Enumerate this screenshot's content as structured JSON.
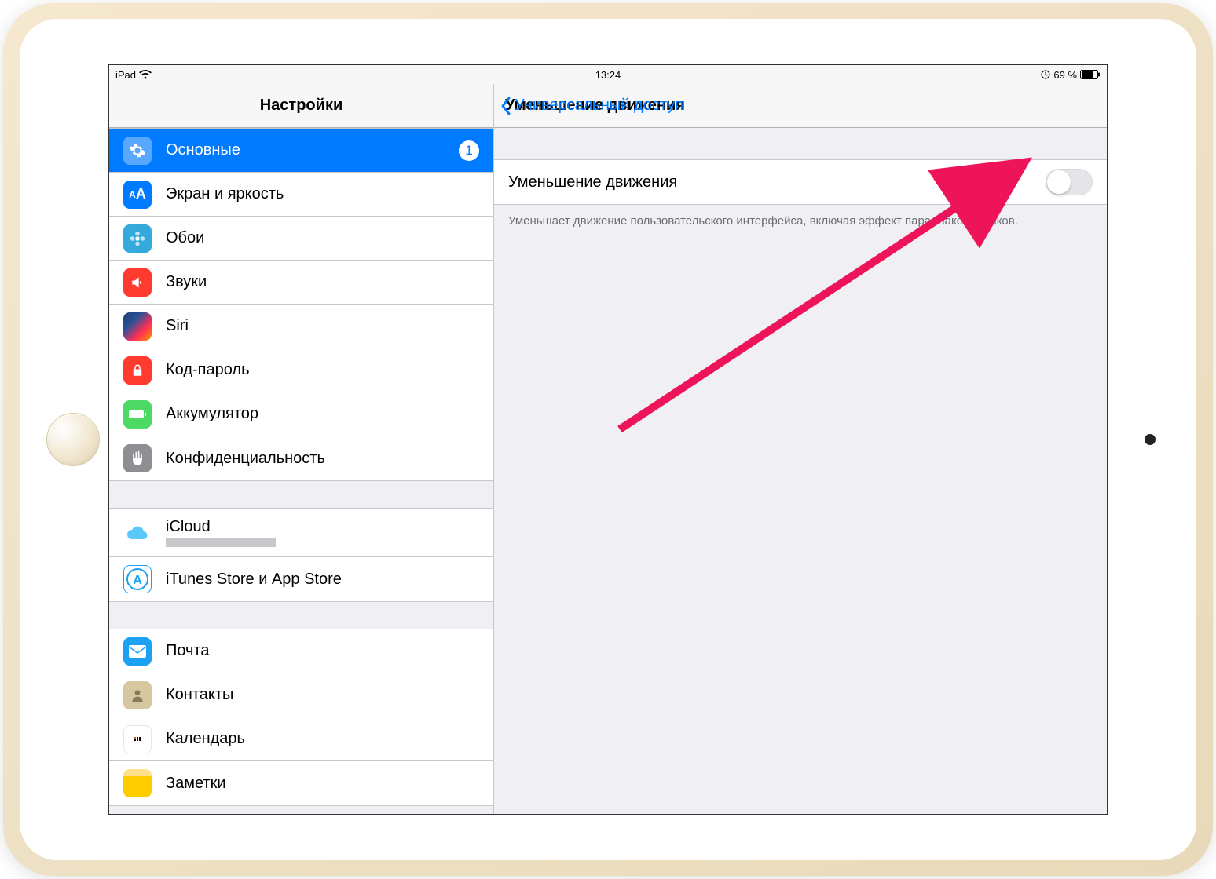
{
  "statusbar": {
    "carrier": "iPad",
    "time": "13:24",
    "battery": "69 %"
  },
  "sidebar": {
    "title": "Настройки",
    "groups": [
      [
        {
          "icon": "general",
          "label": "Основные",
          "selected": true,
          "badge": "1"
        },
        {
          "icon": "display",
          "label": "Экран и яркость"
        },
        {
          "icon": "wallpaper",
          "label": "Обои"
        },
        {
          "icon": "sounds",
          "label": "Звуки"
        },
        {
          "icon": "siri",
          "label": "Siri"
        },
        {
          "icon": "passcode",
          "label": "Код-пароль"
        },
        {
          "icon": "battery",
          "label": "Аккумулятор"
        },
        {
          "icon": "privacy",
          "label": "Конфиденциальность"
        }
      ],
      [
        {
          "icon": "icloud",
          "label": "iCloud",
          "subtitle": true
        },
        {
          "icon": "itunes",
          "label": "iTunes Store и App Store"
        }
      ],
      [
        {
          "icon": "mail",
          "label": "Почта"
        },
        {
          "icon": "contacts",
          "label": "Контакты"
        },
        {
          "icon": "calendar",
          "label": "Календарь"
        },
        {
          "icon": "notes",
          "label": "Заметки"
        }
      ]
    ]
  },
  "detail": {
    "back": "Универсальный доступ",
    "title": "Уменьшение движения",
    "toggle_label": "Уменьшение движения",
    "footer": "Уменьшает движение пользовательского интерфейса, включая эффект параллакса значков."
  }
}
